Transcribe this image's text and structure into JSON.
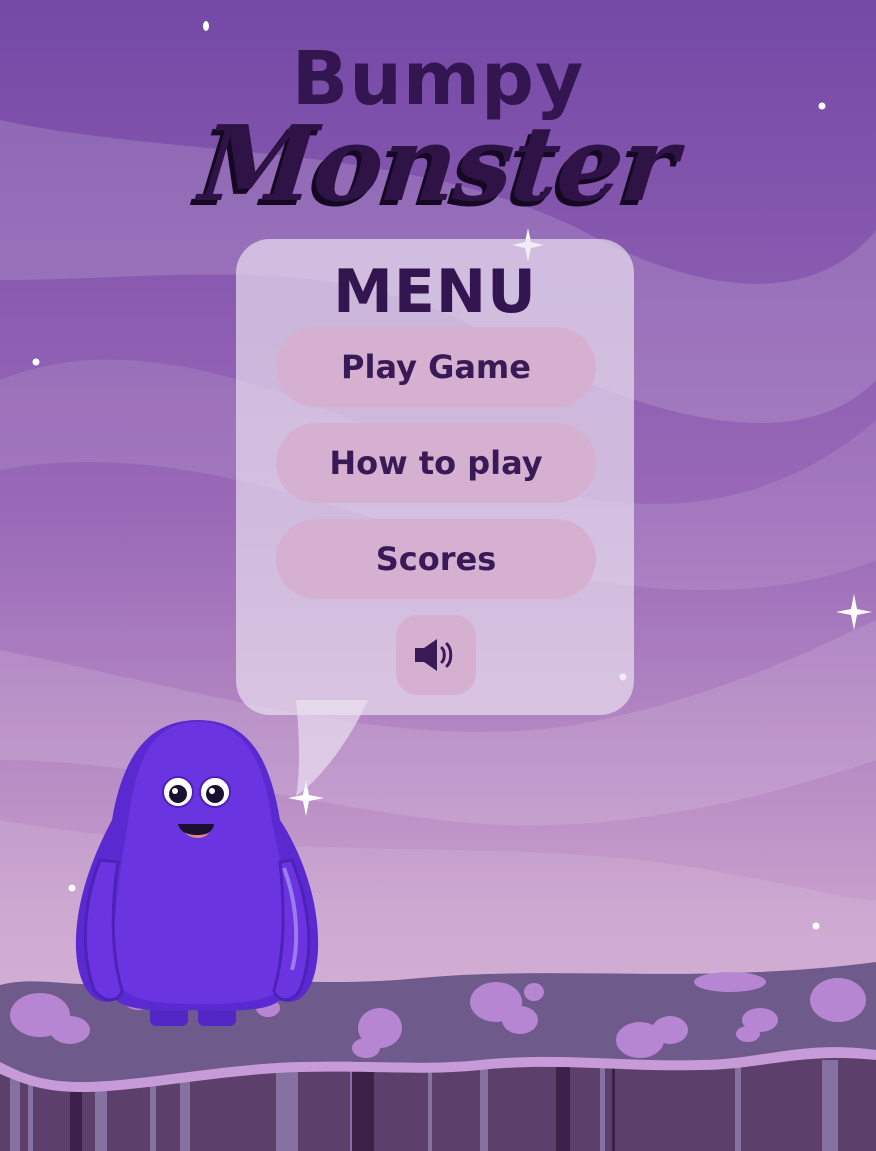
{
  "title": {
    "line1": "Bumpy",
    "line2": "Monster"
  },
  "menu": {
    "heading": "MENU",
    "buttons": [
      {
        "label": "Play Game"
      },
      {
        "label": "How to play"
      },
      {
        "label": "Scores"
      }
    ],
    "sound_icon": "speaker-volume-icon"
  },
  "colors": {
    "sky_top": "#7448a6",
    "sky_bottom": "#d4a9cf",
    "title": "#33154f",
    "panel": "#ece2f0",
    "button": "#d6b0d0",
    "monster": "#6a34e0",
    "ground": "#6f5a8c"
  }
}
